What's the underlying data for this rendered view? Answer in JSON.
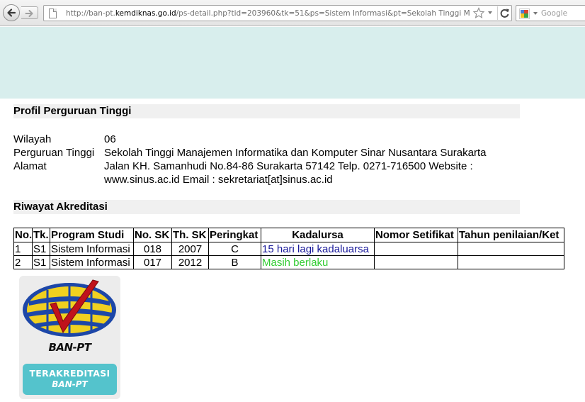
{
  "browser": {
    "url_prefix": "http://ban-pt.",
    "url_host": "kemdiknas.go.id",
    "url_path": "/ps-detail.php?tid=203960&tk=51&ps=Sistem Informasi&pt=Sekolah Tinggi Manajemen",
    "search_placeholder": "Google",
    "icons": [
      "back-icon",
      "forward-icon",
      "page-icon",
      "star-icon",
      "dropdown-icon",
      "reload-icon",
      "google-icon"
    ]
  },
  "profil": {
    "heading": "Profil Perguruan Tinggi",
    "rows": [
      {
        "label": "Wilayah",
        "value": "06"
      },
      {
        "label": "Perguruan Tinggi",
        "value": "Sekolah Tinggi Manajemen Informatika dan Komputer Sinar Nusantara Surakarta"
      },
      {
        "label": "Alamat",
        "value": "Jalan KH. Samanhudi No.84-86 Surakarta 57142 Telp. 0271-716500 Website : www.sinus.ac.id Email : sekretariat[at]sinus.ac.id"
      }
    ]
  },
  "riwayat": {
    "heading": "Riwayat Akreditasi",
    "columns": [
      "No.",
      "Tk.",
      "Program Studi",
      "No. SK",
      "Th. SK",
      "Peringkat",
      "Kadalursa",
      "Nomor Setifikat",
      "Tahun penilaian/Ket"
    ],
    "rows": [
      [
        "1",
        "S1",
        "Sistem Informasi",
        "018",
        "2007",
        "C",
        "15 hari lagi kadaluarsa",
        "",
        ""
      ],
      [
        "2",
        "S1",
        "Sistem Informasi",
        "017",
        "2012",
        "B",
        "Masih berlaku",
        "",
        ""
      ]
    ],
    "status_colors": {
      "expiring": "#1a1a9a",
      "valid": "#33cc33"
    }
  },
  "logo": {
    "name": "BAN-PT",
    "badge_line1": "TERAKREDITASI",
    "badge_line2": "BAN-PT"
  },
  "colors": {
    "banner": "#d8eeed",
    "section_bar": "#f0f0f0",
    "badge": "#54c3cc"
  }
}
